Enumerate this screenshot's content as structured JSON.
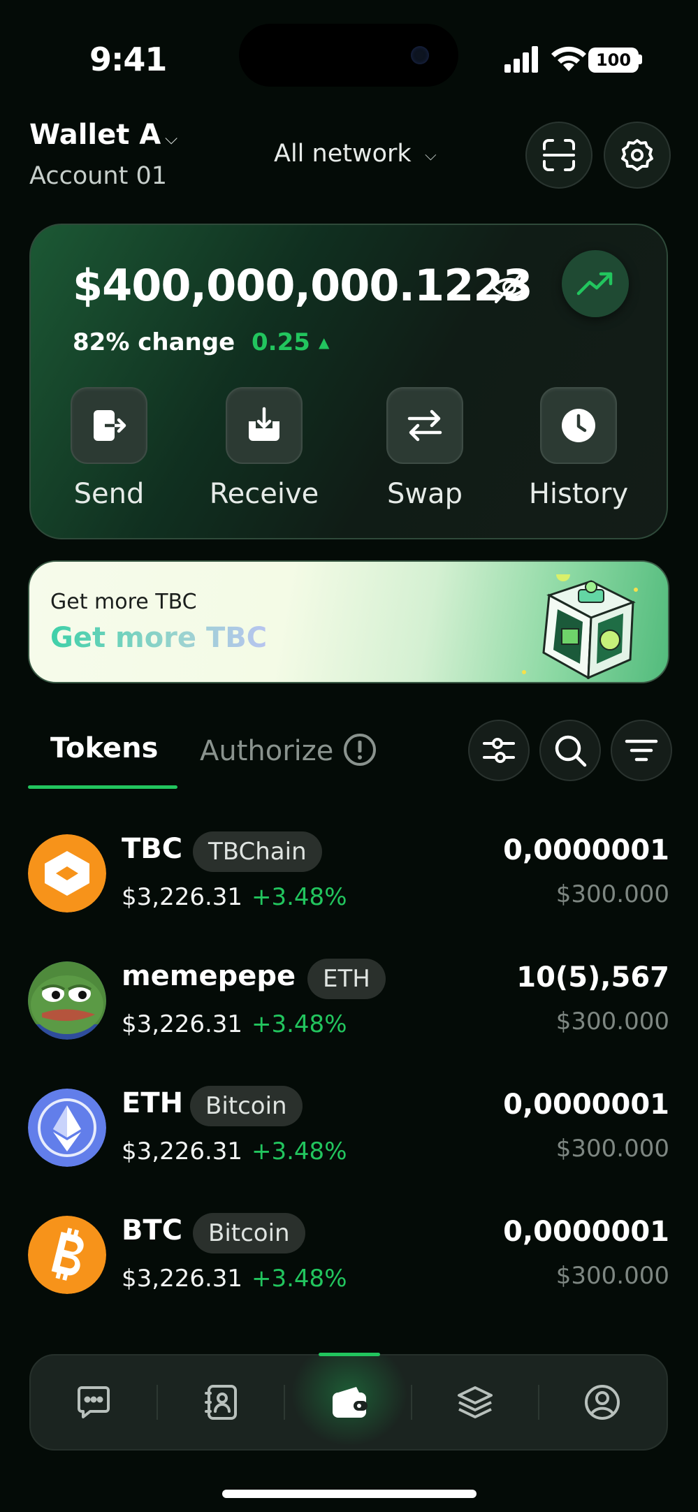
{
  "status_bar": {
    "time": "9:41",
    "battery": "100"
  },
  "header": {
    "wallet_name": "Wallet A",
    "account_name": "Account 01",
    "network": "All network"
  },
  "balance": {
    "amount": "$400,000,000.1223",
    "change_label": "82% change",
    "change_value": "0.25"
  },
  "actions": [
    {
      "label": "Send",
      "icon": "send-icon"
    },
    {
      "label": "Receive",
      "icon": "receive-icon"
    },
    {
      "label": "Swap",
      "icon": "swap-icon"
    },
    {
      "label": "History",
      "icon": "history-icon"
    }
  ],
  "banner": {
    "small": "Get more TBC",
    "big": "Get more TBC"
  },
  "tabs": {
    "tokens": "Tokens",
    "authorize": "Authorize"
  },
  "tokens": [
    {
      "symbol": "TBC",
      "chain": "TBChain",
      "price": "$3,226.31",
      "change": "+3.48%",
      "amount": "0,0000001",
      "value": "$300.000"
    },
    {
      "symbol": "memepepe",
      "chain": "ETH",
      "price": "$3,226.31",
      "change": "+3.48%",
      "amount": "10(5),567",
      "value": "$300.000"
    },
    {
      "symbol": "ETH",
      "chain": "Bitcoin",
      "price": "$3,226.31",
      "change": "+3.48%",
      "amount": "0,0000001",
      "value": "$300.000"
    },
    {
      "symbol": "BTC",
      "chain": "Bitcoin",
      "price": "$3,226.31",
      "change": "+3.48%",
      "amount": "0,0000001",
      "value": "$300.000"
    }
  ],
  "bottom_nav": [
    "chat-icon",
    "contacts-icon",
    "wallet-icon",
    "layers-icon",
    "profile-icon"
  ],
  "colors": {
    "accent": "#22c55e",
    "background": "#040b07",
    "tbc_orange": "#f7931a",
    "eth_blue": "#627eea",
    "btc_orange": "#f7931a"
  }
}
